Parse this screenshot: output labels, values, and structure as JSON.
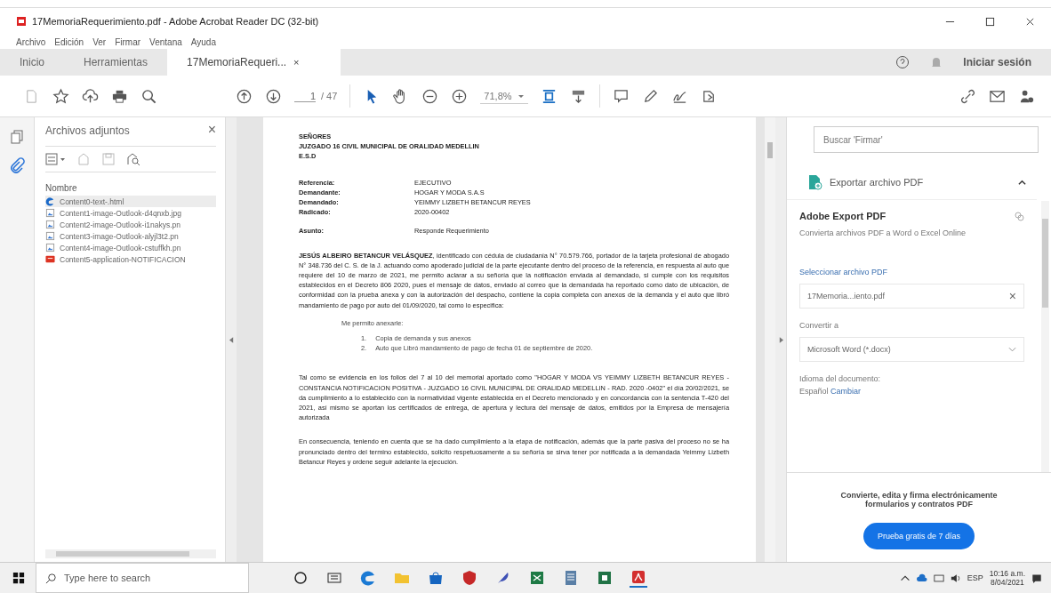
{
  "window": {
    "title": "17MemoriaRequerimiento.pdf - Adobe Acrobat Reader DC (32-bit)"
  },
  "menu": [
    "Archivo",
    "Edición",
    "Ver",
    "Firmar",
    "Ventana",
    "Ayuda"
  ],
  "tabs": [
    {
      "label": "Inicio",
      "selected": false
    },
    {
      "label": "Herramientas",
      "selected": false
    },
    {
      "label": "17MemoriaRequeri...",
      "selected": true,
      "close": "×"
    }
  ],
  "sign_in": "Iniciar sesión",
  "toolbar": {
    "page": "1",
    "page_count": "/ 47",
    "zoom": "71,8%"
  },
  "attachments": {
    "title": "Archivos adjuntos",
    "close": "×",
    "column": "Nombre",
    "items": [
      {
        "name": "Content0-text-.html",
        "kind": "web",
        "selected": true
      },
      {
        "name": "Content1-image-Outlook-d4qnxb.jpg",
        "kind": "image",
        "selected": false
      },
      {
        "name": "Content2-image-Outlook-i1nakys.pn",
        "kind": "image",
        "selected": false
      },
      {
        "name": "Content3-image-Outlook-alyjl3t2.pn",
        "kind": "image",
        "selected": false
      },
      {
        "name": "Content4-image-Outlook-cstuffkh.pn",
        "kind": "image",
        "selected": false
      },
      {
        "name": "Content5-application-NOTIFICACION",
        "kind": "pdf",
        "selected": false
      }
    ]
  },
  "document": {
    "address": [
      "SEÑORES",
      "JUZGADO 16 CIVIL MUNICIPAL DE ORALIDAD MEDELLIN",
      "E.S.D"
    ],
    "fields": [
      {
        "label": "Referencia:",
        "value": "EJECUTIVO"
      },
      {
        "label": "Demandante:",
        "value": "HOGAR Y MODA S.A.S"
      },
      {
        "label": "Demandado:",
        "value": "YEIMMY LIZBETH BETANCUR REYES"
      },
      {
        "label": "Radicado:",
        "value": "2020-00402"
      }
    ],
    "subject": {
      "label": "Asunto:",
      "value": "Responde Requerimiento"
    },
    "paragraph_1": "**JESÚS ALBEIRO BETANCUR VELÁSQUEZ**, identificado con cédula de ciudadanía N° 70.579.766, portador de la tarjeta profesional de abogado N° 348.736 del C. S. de la J. actuando como apoderado judicial de la parte ejecutante dentro del proceso de la referencia, en respuesta al auto que requiere del 10 de marzo de 2021, me permito aclarar a su señoría que la notificación enviada al demandado, si cumple con los requisitos establecidos en el Decreto 806 2020, pues el mensaje de datos, enviado al correo que la demandada ha reportado como dato de ubicación, de conformidad con la prueba anexa y con la autorización del despacho, contiene la copia completa con anexos de la demanda y el auto que libró mandamiento de pago por auto del 01/09/2020, tal como lo especifica:",
    "list_intro": "Me permito anexarle:",
    "list": [
      {
        "number": "1.",
        "text": "Copia de demanda y sus anexos"
      },
      {
        "number": "2.",
        "text": "Auto que Libró mandamiento de pago de fecha 01 de septiembre de 2020."
      }
    ],
    "paragraph_2": "Tal como se evidencia en los folios del 7 al 10 del memorial aportado como \"HOGAR Y MODA VS YEIMMY LIZBETH BETANCUR REYES -CONSTANCIA NOTIFICACION POSITIVA - JUZGADO 16 CIVIL MUNICIPAL DE ORALIDAD MEDELLIN - RAD. 2020 -0402\" el día 20/02/2021, se da cumplimiento a lo establecido con la normatividad vigente establecida en el Decreto mencionado y en concordancia con la sentencia T-420 del 2021, así mismo se aportan los certificados de entrega, de apertura y lectura del mensaje de datos, emitidos por la Empresa de mensajería autorizada",
    "paragraph_3": "En consecuencia, teniendo en cuenta que se ha dado cumplimiento a la etapa de notificación, además que la parte pasiva del proceso no se ha pronunciado dentro del termino establecido, solicito respetuosamente a su señoría se sirva tener por notificada a la demandada Yeimmy Lizbeth Betancur Reyes y ordene seguir adelante la ejecución."
  },
  "right_panel": {
    "search": {
      "placeholder": "Buscar 'Firmar'"
    },
    "section": {
      "title": "Exportar archivo PDF",
      "expanded": true
    },
    "heading": "Adobe Export PDF",
    "description": "Convierta archivos PDF a Word o Excel Online",
    "select_label": "Seleccionar archivo PDF",
    "file": "17Memoria...iento.pdf",
    "file_clear": "×",
    "convert_label": "Convertir a",
    "format": "Microsoft Word (*.docx)",
    "language_label": "Idioma del documento:",
    "language": "Español",
    "change_link": "Cambiar",
    "promo": "Convierte, edita y firma electrónicamente formularios y contratos PDF",
    "trial_button": "Prueba gratis de 7 días"
  },
  "taskbar": {
    "search": {
      "placeholder": "Type here to search"
    },
    "language": "ESP",
    "time": "10:16 a.m.",
    "date": "8/04/2021"
  }
}
